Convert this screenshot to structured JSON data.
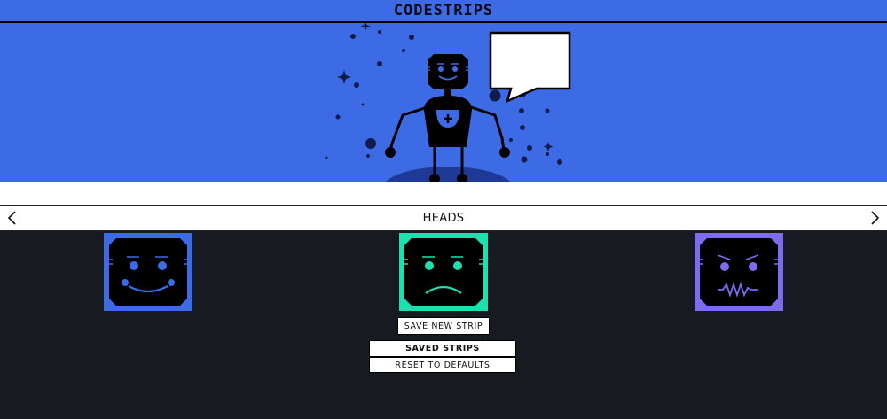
{
  "app": {
    "title": "CODESTRIPS"
  },
  "scene": {
    "speech_bubble_text": "",
    "background_color": "#3d6be6",
    "planet_color": "#1f3a96",
    "star_color": "#101c4a"
  },
  "selector": {
    "category": "HEADS",
    "prev_icon": "chevron-left-icon",
    "next_icon": "chevron-right-icon",
    "options": [
      {
        "name": "happy-head",
        "color": "#3d6be6"
      },
      {
        "name": "sad-head",
        "color": "#1de0b0"
      },
      {
        "name": "angry-head",
        "color": "#7b6cf0"
      }
    ]
  },
  "actions": {
    "save_new_strip": "SAVE NEW STRIP",
    "saved_strips": "SAVED STRIPS",
    "reset_defaults": "RESET TO DEFAULTS"
  }
}
